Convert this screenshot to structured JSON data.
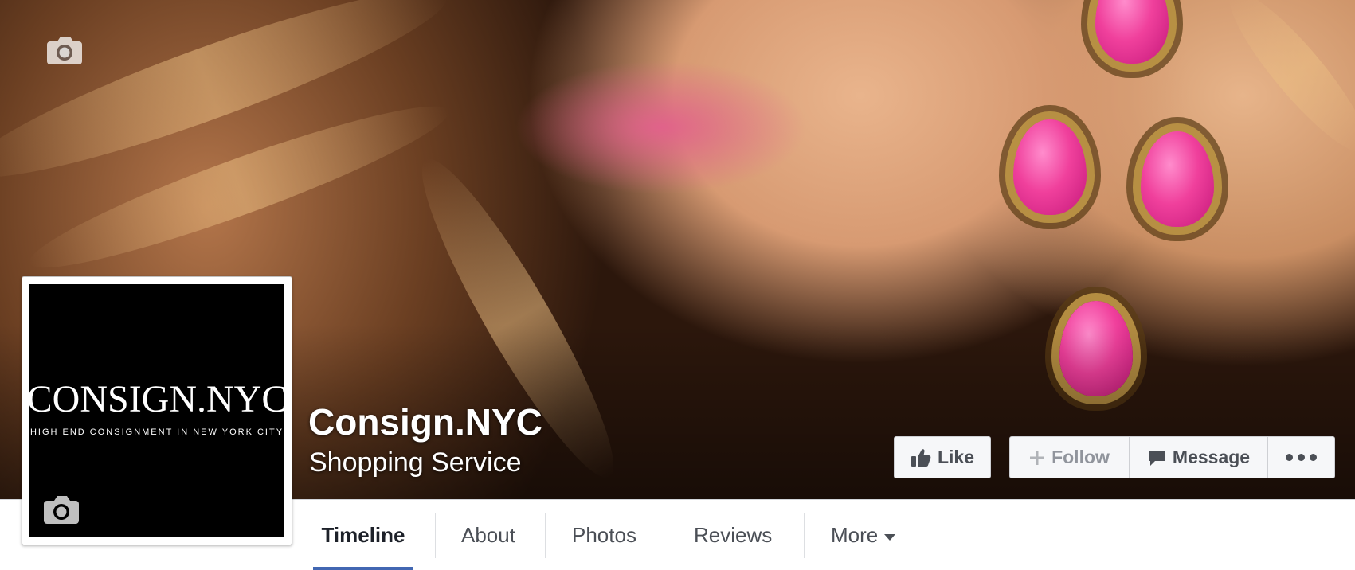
{
  "page": {
    "name": "Consign.NYC",
    "category": "Shopping Service"
  },
  "profile_logo": {
    "main": "CONSIGN.NYC",
    "tagline": "HIGH END CONSIGNMENT IN NEW YORK CITY"
  },
  "actions": {
    "like_label": "Like",
    "follow_label": "Follow",
    "message_label": "Message"
  },
  "tabs": [
    {
      "label": "Timeline",
      "active": true
    },
    {
      "label": "About",
      "active": false
    },
    {
      "label": "Photos",
      "active": false
    },
    {
      "label": "Reviews",
      "active": false
    },
    {
      "label": "More",
      "active": false
    }
  ],
  "icons": {
    "cover_camera": "camera-icon",
    "profile_camera": "camera-icon",
    "like": "thumbs-up-icon",
    "follow": "plus-icon",
    "message": "speech-bubble-icon",
    "more_actions": "ellipsis-icon",
    "more_tab": "caret-down-icon"
  },
  "colors": {
    "accent": "#4267b2",
    "button_bg": "#f6f7f9",
    "button_text": "#4b4f56"
  }
}
